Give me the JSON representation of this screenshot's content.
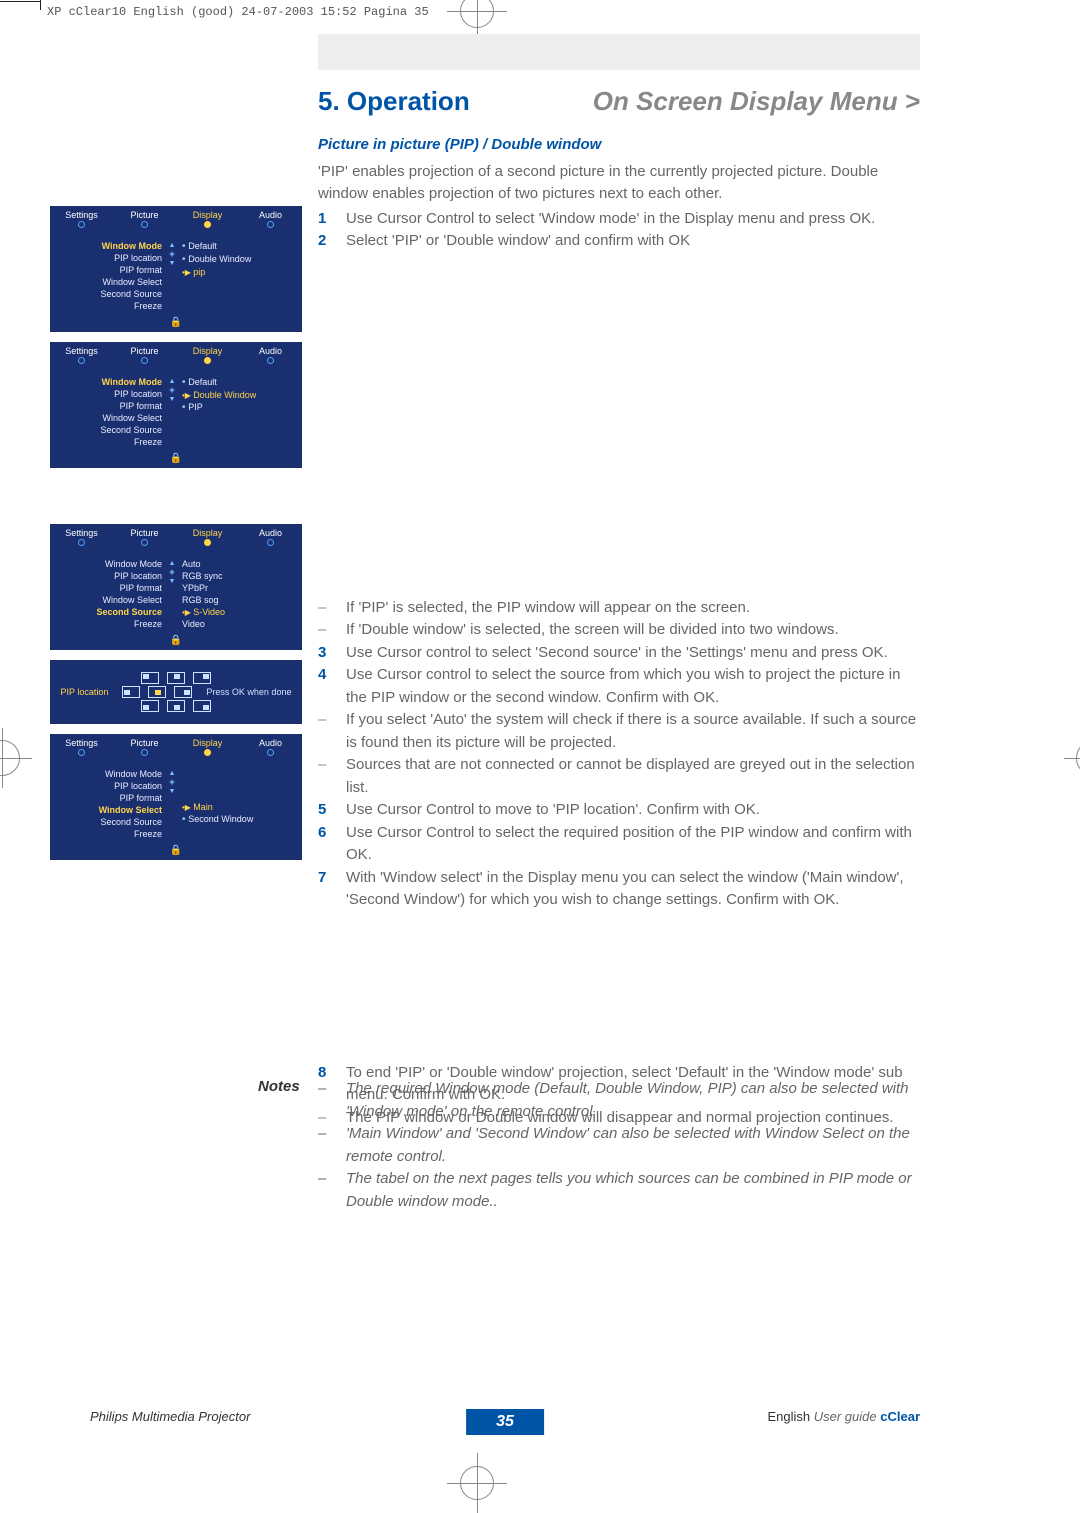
{
  "crop_header": "XP cClear10 English (good)  24-07-2003  15:52  Pagina 35",
  "heading_left": "5. Operation",
  "heading_right": "On Screen Display Menu >",
  "subhead": "Picture in picture (PIP) / Double window",
  "intro_p1": "'PIP' enables projection of a second picture in the currently projected picture. Double window enables projection of two pictures next to each other.",
  "step1": "Use Cursor Control to select 'Window mode' in the Display menu and press OK.",
  "step2": "Select 'PIP' or 'Double window' and confirm with OK",
  "dash1": "If 'PIP' is selected, the PIP window will appear on the screen.",
  "dash2": "If 'Double window' is selected, the screen will be divided into two windows.",
  "step3": "Use Cursor control to select 'Second source' in the 'Settings' menu and press OK.",
  "step4": "Use Cursor control to select the source from which you wish to project the picture in the PIP window or the second window. Confirm with OK.",
  "dash3": "If you select 'Auto' the system will check if there is a source available. If such a source is found then its picture will be projected.",
  "dash4": "Sources that are not connected or cannot be displayed are greyed out in the selection list.",
  "step5": "Use Cursor Control to move to 'PIP location'. Confirm with OK.",
  "step6": "Use Cursor Control to select the required position of the PIP window and confirm with OK.",
  "step7": "With 'Window select' in the Display menu you can select the window ('Main window', 'Second Window') for which you wish to change settings. Confirm with OK.",
  "step8": "To end 'PIP' or 'Double window' projection, select 'Default' in the 'Window mode' sub menu. Confirm with OK.",
  "dash5": "The PIP window or Double window will disappear and normal projection continues.",
  "notes_label": "Notes",
  "note1": "The required Window mode (Default, Double Window, PIP) can also be selected with 'Window mode' on the remote control.",
  "note2": "'Main Window' and 'Second Window' can also be selected with Window Select on the remote control.",
  "note3": "The tabel on the next pages tells you which sources can be combined in PIP mode or Double window mode..",
  "footer_left": "Philips Multimedia Projector",
  "footer_page": "35",
  "footer_lang": "English",
  "footer_ug": "User guide",
  "footer_brand": "cClear",
  "tabs": {
    "settings": "Settings",
    "picture": "Picture",
    "display": "Display",
    "audio": "Audio"
  },
  "menu_items": {
    "window_mode": "Window Mode",
    "pip_location": "PIP location",
    "pip_format": "PIP format",
    "window_select": "Window Select",
    "second_source": "Second Source",
    "freeze": "Freeze"
  },
  "menu1_opts": {
    "default": "Default",
    "double_window": "Double Window",
    "pip": "pip"
  },
  "menu2_opts": {
    "default": "Default",
    "double_window": "Double Window",
    "pip": "PIP"
  },
  "menu3_opts": {
    "auto": "Auto",
    "rgb_sync": "RGB sync",
    "ypbpr": "YPbPr",
    "rgb_sog": "RGB sog",
    "svideo": "S-Video",
    "video": "Video"
  },
  "menu4_opts": {
    "main": "Main",
    "second_window": "Second Window"
  },
  "pip_menu": {
    "label": "PIP location",
    "note": "Press OK when done"
  }
}
